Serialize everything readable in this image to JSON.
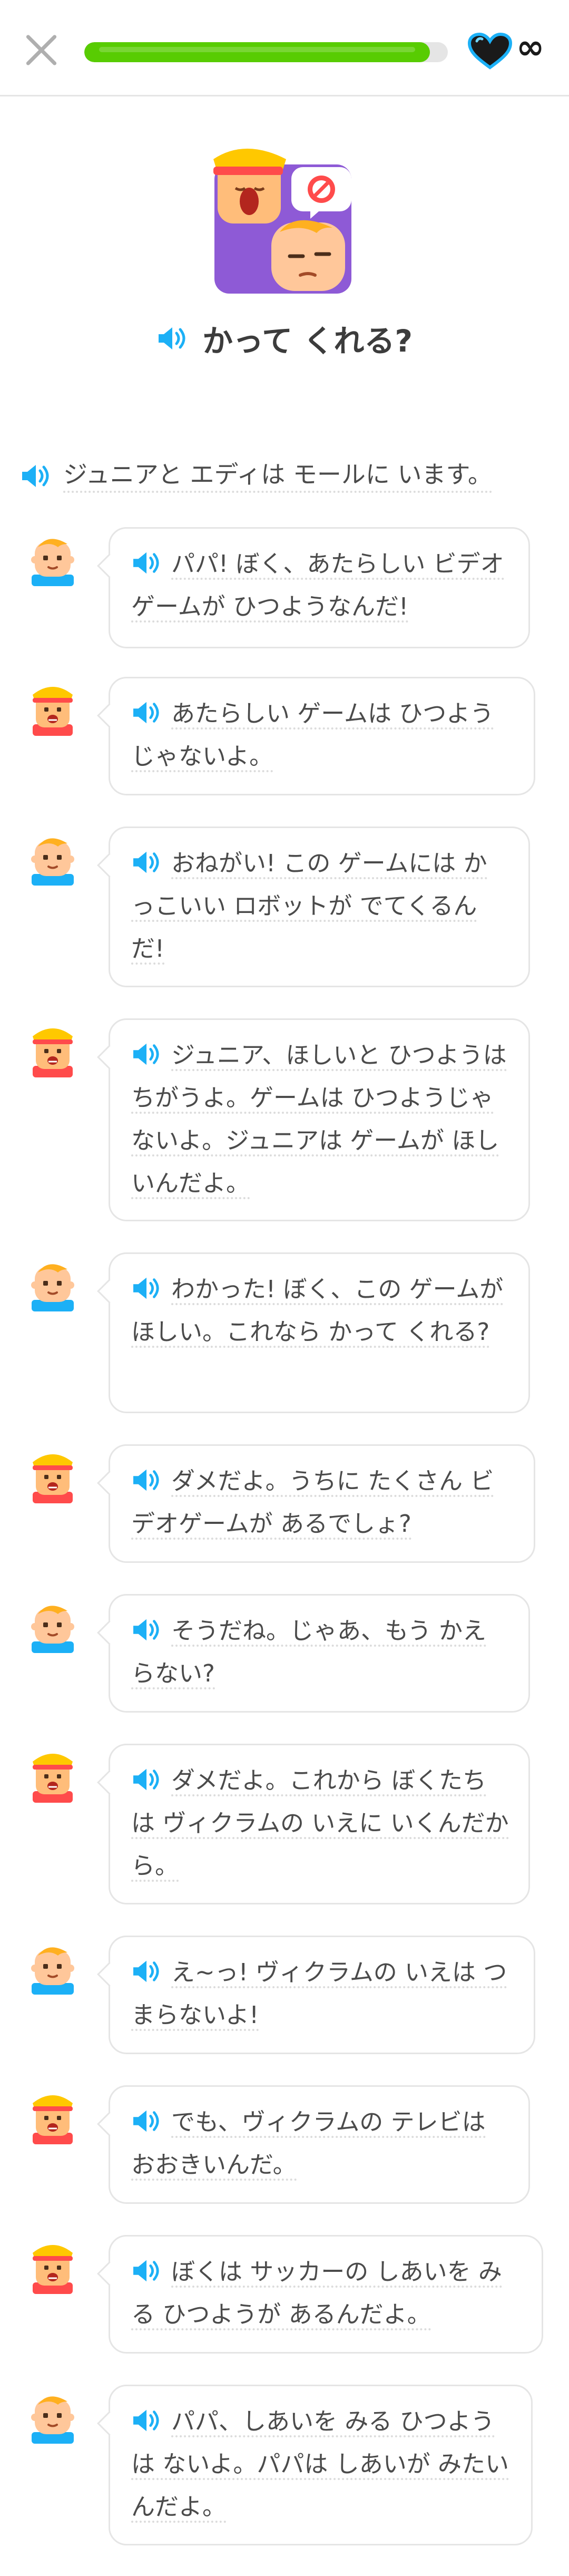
{
  "header": {
    "close_icon": "close-icon",
    "progress": 0.95,
    "hearts_symbol": "∞",
    "accent": "#58cc02"
  },
  "lesson": {
    "title": "かって くれる?",
    "intro": "ジュニアと エディは モールに います。"
  },
  "messages": [
    {
      "speaker": "junior",
      "text": "パパ! ぼく、あたらしい ビデオゲームが ひつようなんだ!"
    },
    {
      "speaker": "eddy",
      "text": "あたらしい ゲームは ひつようじゃないよ。"
    },
    {
      "speaker": "junior",
      "text": "おねがい! この ゲームには かっこいい ロボットが でてくるんだ!"
    },
    {
      "speaker": "eddy",
      "text": "ジュニア、ほしいと ひつようは ちがうよ。ゲームは ひつようじゃないよ。ジュニアは ゲームが ほしいんだよ。"
    },
    {
      "speaker": "junior",
      "text": "わかった! ぼく、この ゲームが ほしい。これなら かって くれる?"
    },
    {
      "speaker": "eddy",
      "text": "ダメだよ。うちに たくさん ビデオゲームが あるでしょ?"
    },
    {
      "speaker": "junior",
      "text": "そうだね。じゃあ、もう かえらない?"
    },
    {
      "speaker": "eddy",
      "text": "ダメだよ。これから ぼくたちは ヴィクラムの いえに いくんだから。"
    },
    {
      "speaker": "junior",
      "text": "え~っ! ヴィクラムの いえは つまらないよ!"
    },
    {
      "speaker": "eddy",
      "text": "でも、ヴィクラムの テレビは おおきいんだ。"
    },
    {
      "speaker": "eddy",
      "text": "ぼくは サッカーの しあいを みる ひつようが あるんだよ。"
    },
    {
      "speaker": "junior",
      "text": "パパ、しあいを みる ひつようは ないよ。パパは しあいが みたいんだよ。"
    }
  ]
}
